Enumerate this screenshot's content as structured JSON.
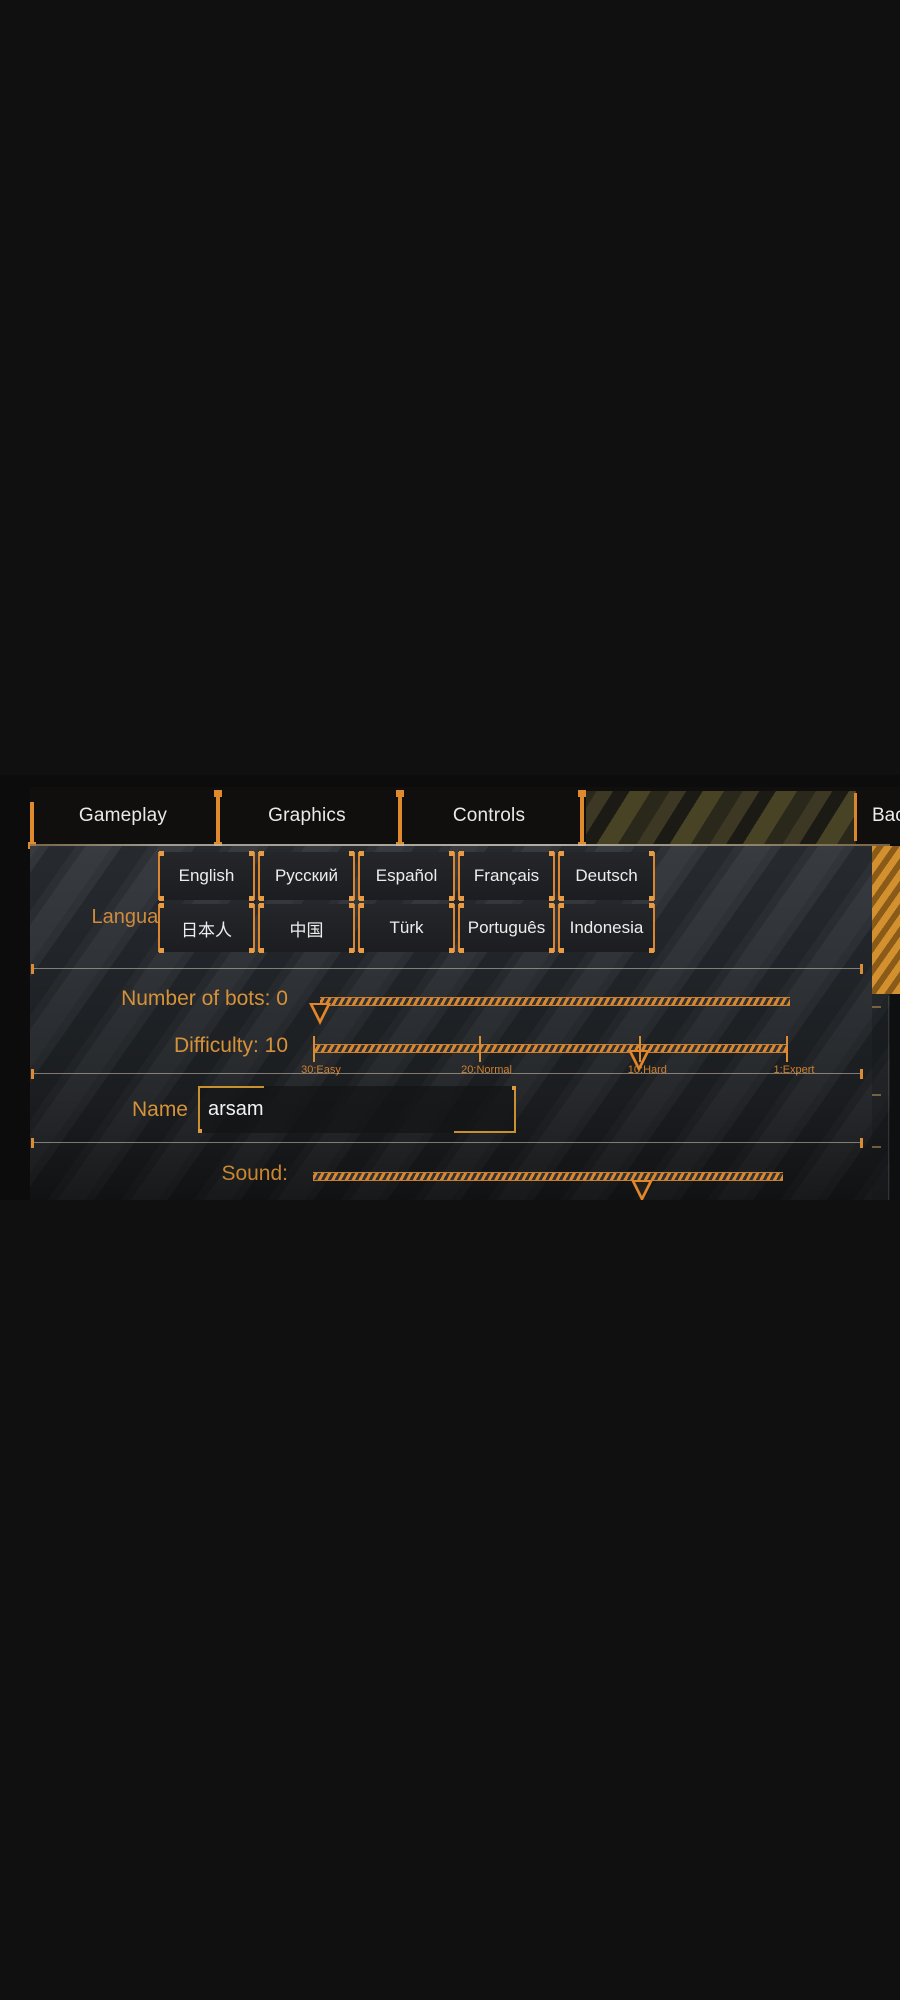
{
  "tabs": [
    {
      "id": "gameplay",
      "label": "Gameplay",
      "active": true
    },
    {
      "id": "graphics",
      "label": "Graphics",
      "active": false
    },
    {
      "id": "controls",
      "label": "Controls",
      "active": false
    }
  ],
  "back": {
    "label": "Back",
    "icon": "arrow-left-icon"
  },
  "settings": {
    "language": {
      "label": "Language:",
      "options": [
        "English",
        "Русский",
        "Español",
        "Français",
        "Deutsch",
        "日本人",
        "中国",
        "Türk",
        "Português",
        "Indonesia"
      ]
    },
    "bots": {
      "label": "Number of bots: 0",
      "value": 0,
      "percent": 0
    },
    "difficulty": {
      "label": "Difficulty: 10",
      "value": 10,
      "percent": 69,
      "ticks": [
        {
          "label": "30:Easy",
          "percent": 0
        },
        {
          "label": "20:Normal",
          "percent": 35
        },
        {
          "label": "10:Hard",
          "percent": 69
        },
        {
          "label": "1:Expert",
          "percent": 100
        }
      ]
    },
    "name": {
      "label": "Name",
      "value": "arsam",
      "placeholder": ""
    },
    "sound": {
      "label": "Sound:",
      "percent": 70
    }
  },
  "colors": {
    "accent": "#d9862f",
    "accent_text": "#d59239",
    "panel_text": "#ededed",
    "background": "#101010"
  }
}
